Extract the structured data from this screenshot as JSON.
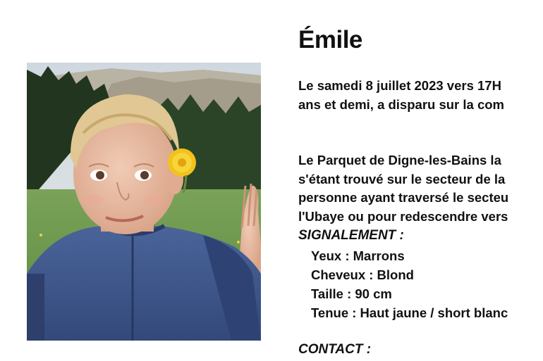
{
  "notice": {
    "title": "Émile",
    "paragraph1": [
      "Le samedi 8 juillet 2023 vers 17H",
      "ans et demi, a disparu sur la com"
    ],
    "paragraph2": [
      "Le Parquet de Digne-les-Bains la",
      "s'étant trouvé sur le secteur de la",
      "personne ayant traversé le secteu",
      "l'Ubaye ou pour redescendre vers"
    ],
    "signalement": {
      "heading": "SIGNALEMENT :",
      "items": [
        "Yeux : Marrons",
        "Cheveux : Blond",
        "Taille : 90 cm",
        "Tenue : Haut jaune / short blanc"
      ]
    },
    "contact": {
      "heading": "CONTACT :"
    }
  },
  "colors": {
    "text": "#111111",
    "background": "#ffffff",
    "fleece": "#3f5a8c",
    "flower": "#f2c21b"
  }
}
